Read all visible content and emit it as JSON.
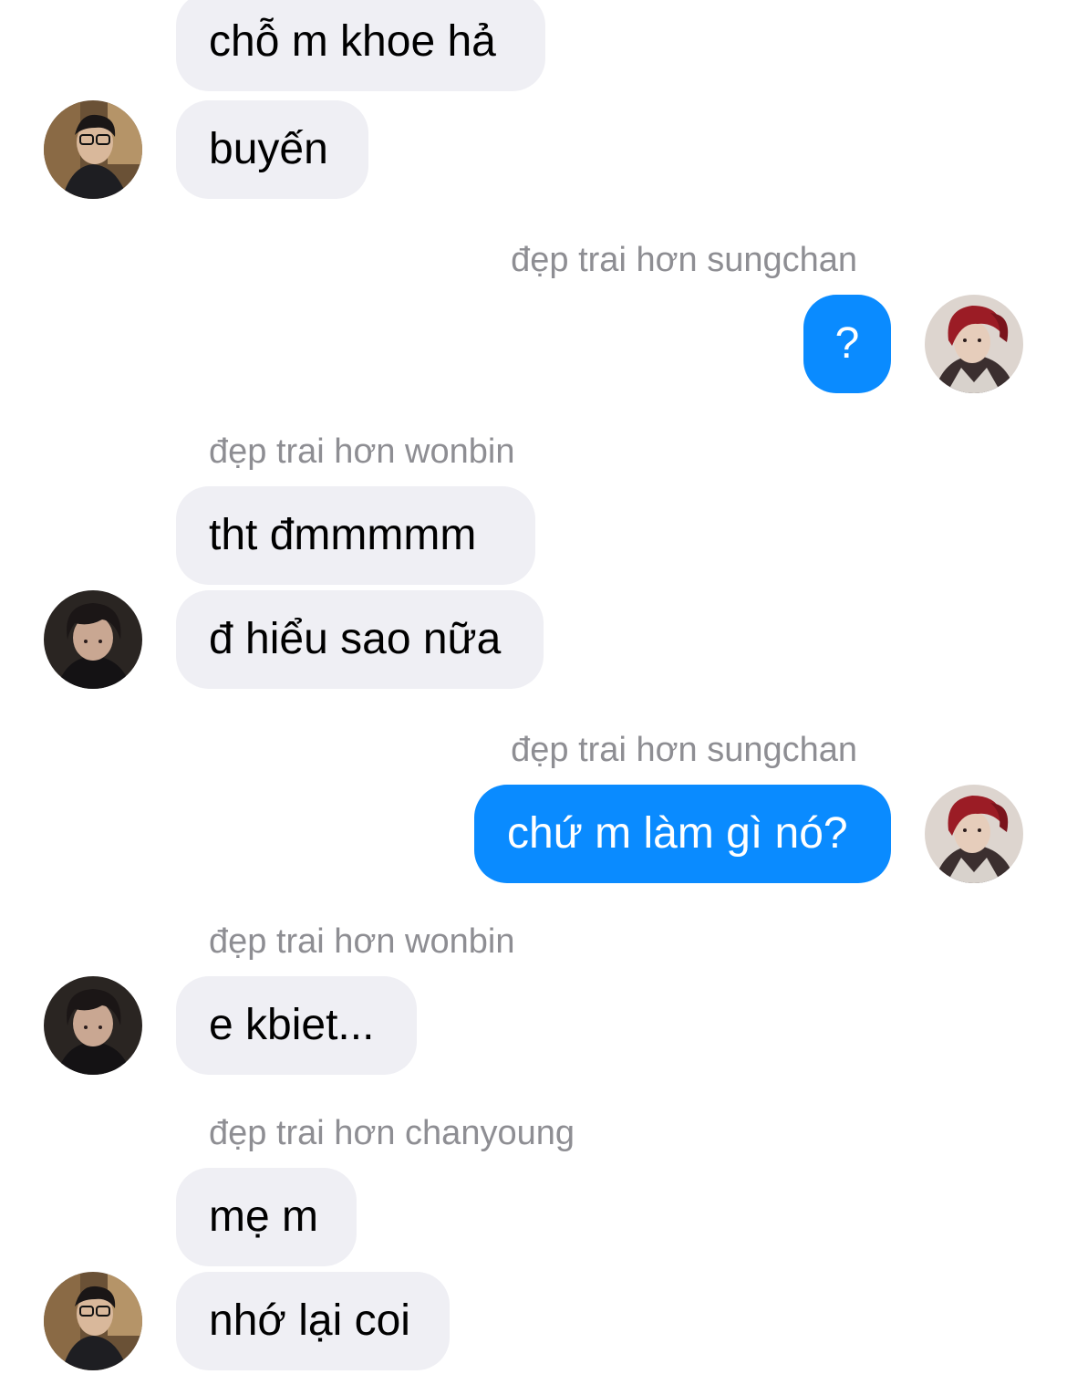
{
  "messages": {
    "m1": "chỗ m khoe hả",
    "m2": "buyến",
    "m3": "?",
    "m4": "tht đmmmmm",
    "m5": "đ hiểu sao nữa",
    "m6": "chứ m làm gì nó?",
    "m7": "e kbiet...",
    "m8": "mẹ m",
    "m9": "nhớ lại coi"
  },
  "senders": {
    "s1": "đẹp trai hơn sungchan",
    "s2": "đẹp trai hơn wonbin",
    "s3": "đẹp trai hơn sungchan",
    "s4": "đẹp trai hơn wonbin",
    "s5": "đẹp trai hơn chanyoung"
  },
  "colors": {
    "incoming_bubble": "#efeff4",
    "outgoing_bubble": "#0a8bff",
    "sender_label": "#8e8e93"
  }
}
